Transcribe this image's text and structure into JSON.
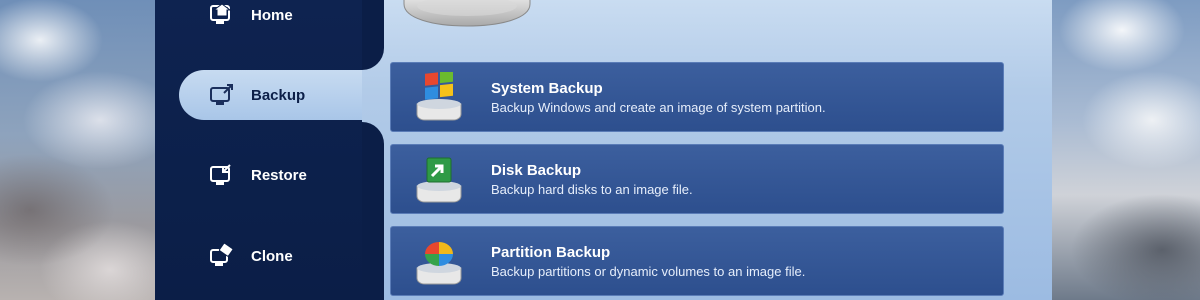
{
  "sidebar": {
    "items": [
      {
        "label": "Home",
        "icon": "home-icon"
      },
      {
        "label": "Backup",
        "icon": "backup-icon",
        "active": true
      },
      {
        "label": "Restore",
        "icon": "restore-icon"
      },
      {
        "label": "Clone",
        "icon": "clone-icon"
      }
    ]
  },
  "main": {
    "cards": [
      {
        "title": "System Backup",
        "description": "Backup Windows and create an image of system partition.",
        "icon": "windows-drive-icon"
      },
      {
        "title": "Disk Backup",
        "description": "Backup hard disks to an image file.",
        "icon": "disk-backup-icon"
      },
      {
        "title": "Partition Backup",
        "description": "Backup partitions or dynamic volumes to an image file.",
        "icon": "partition-pie-icon"
      }
    ]
  },
  "colors": {
    "sidebar_bg": "#0b1e47",
    "content_bg": "#b2cbe8",
    "card_bg": "#2d4f8e",
    "active_tab": "#a9c6e8"
  }
}
